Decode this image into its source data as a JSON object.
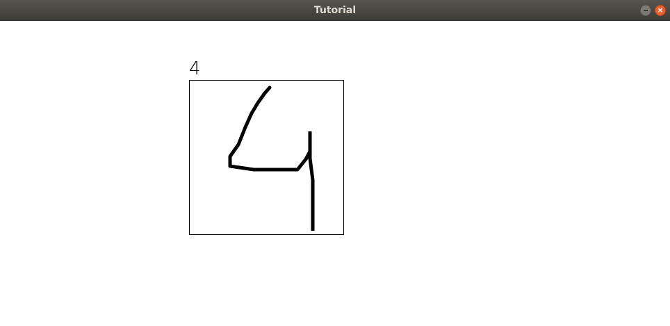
{
  "window": {
    "title": "Tutorial",
    "close_glyph": "×"
  },
  "prediction": {
    "label": "4"
  },
  "drawing": {
    "stroke_color": "#000000"
  }
}
